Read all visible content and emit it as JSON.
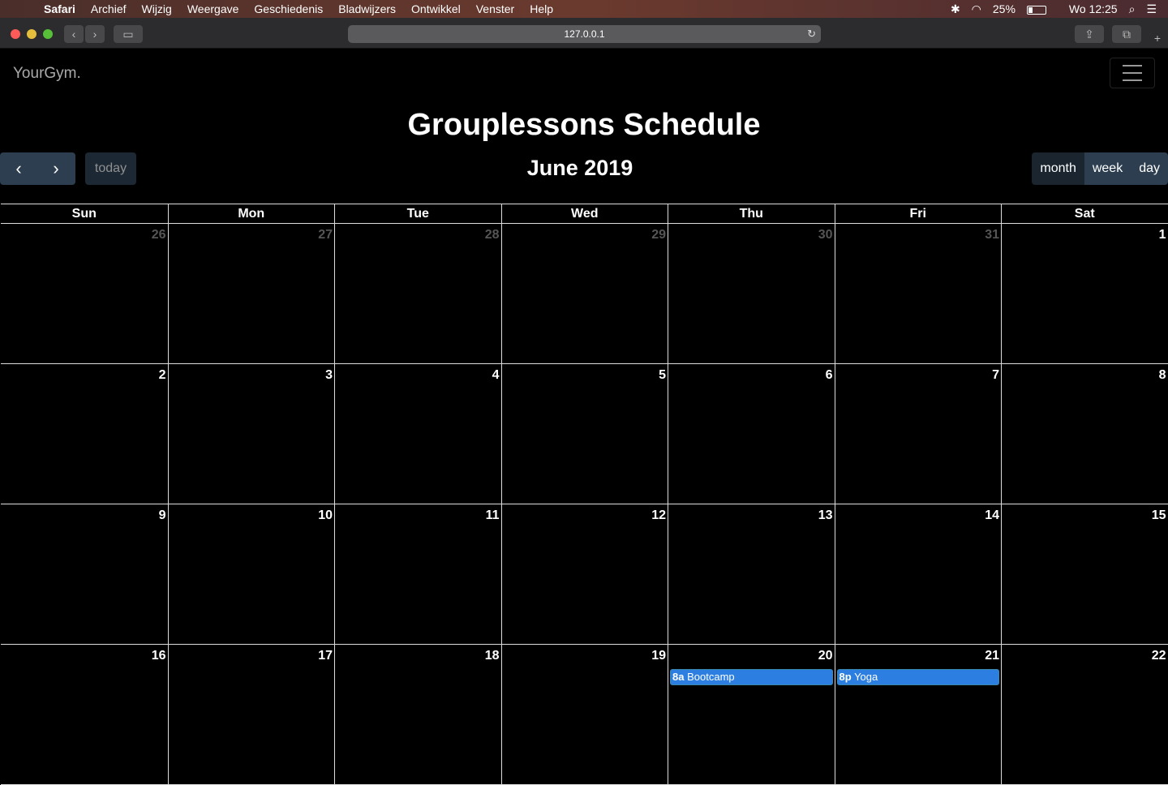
{
  "menubar": {
    "app": "Safari",
    "items": [
      "Archief",
      "Wijzig",
      "Weergave",
      "Geschiedenis",
      "Bladwijzers",
      "Ontwikkel",
      "Venster",
      "Help"
    ],
    "battery": "25%",
    "battery_level": 0.25,
    "clock": "Wo 12:25"
  },
  "browser": {
    "url": "127.0.0.1"
  },
  "site": {
    "brand": "YourGym.",
    "title": "Grouplessons Schedule"
  },
  "calendar": {
    "today_label": "today",
    "month_label": "June 2019",
    "views": [
      "month",
      "week",
      "day"
    ],
    "weekdays": [
      "Sun",
      "Mon",
      "Tue",
      "Wed",
      "Thu",
      "Fri",
      "Sat"
    ],
    "weeks": [
      [
        {
          "d": "26",
          "other": true
        },
        {
          "d": "27",
          "other": true
        },
        {
          "d": "28",
          "other": true
        },
        {
          "d": "29",
          "other": true
        },
        {
          "d": "30",
          "other": true
        },
        {
          "d": "31",
          "other": true
        },
        {
          "d": "1"
        }
      ],
      [
        {
          "d": "2"
        },
        {
          "d": "3"
        },
        {
          "d": "4"
        },
        {
          "d": "5"
        },
        {
          "d": "6"
        },
        {
          "d": "7"
        },
        {
          "d": "8"
        }
      ],
      [
        {
          "d": "9"
        },
        {
          "d": "10"
        },
        {
          "d": "11"
        },
        {
          "d": "12"
        },
        {
          "d": "13"
        },
        {
          "d": "14"
        },
        {
          "d": "15"
        }
      ],
      [
        {
          "d": "16"
        },
        {
          "d": "17"
        },
        {
          "d": "18"
        },
        {
          "d": "19"
        },
        {
          "d": "20",
          "event": {
            "time": "8a",
            "title": "Bootcamp"
          }
        },
        {
          "d": "21",
          "event": {
            "time": "8p",
            "title": "Yoga"
          }
        },
        {
          "d": "22"
        }
      ]
    ]
  },
  "colors": {
    "event": "#2c7fe0",
    "button": "#2c3e50"
  }
}
